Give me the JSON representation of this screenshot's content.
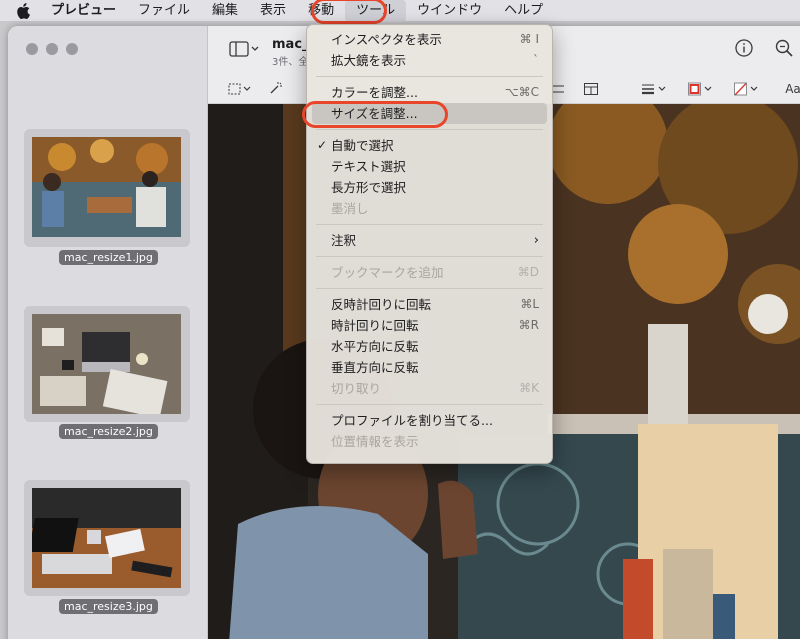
{
  "menubar": {
    "apple_icon": "apple-logo",
    "items": [
      "プレビュー",
      "ファイル",
      "編集",
      "表示",
      "移動",
      "ツール",
      "ウインドウ",
      "ヘルプ"
    ]
  },
  "toolbar": {
    "title": "mac_",
    "subtitle": "3件、全"
  },
  "thumbnails": [
    {
      "label": "mac_resize1.jpg"
    },
    {
      "label": "mac_resize2.jpg"
    },
    {
      "label": "mac_resize3.jpg"
    }
  ],
  "tools_menu": {
    "items": [
      {
        "label": "インスペクタを表示",
        "shortcut": "⌘ I"
      },
      {
        "label": "拡大鏡を表示",
        "shortcut": "`"
      },
      {
        "label": "カラーを調整...",
        "shortcut": "⌥⌘C"
      },
      {
        "label": "サイズを調整..."
      },
      {
        "label": "自動で選択"
      },
      {
        "label": "テキスト選択"
      },
      {
        "label": "長方形で選択"
      },
      {
        "label": "墨消し"
      },
      {
        "label": "注釈"
      },
      {
        "label": "ブックマークを追加",
        "shortcut": "⌘D"
      },
      {
        "label": "反時計回りに回転",
        "shortcut": "⌘L"
      },
      {
        "label": "時計回りに回転",
        "shortcut": "⌘R"
      },
      {
        "label": "水平方向に反転"
      },
      {
        "label": "垂直方向に反転"
      },
      {
        "label": "切り取り",
        "shortcut": "⌘K"
      },
      {
        "label": "プロファイルを割り当てる..."
      },
      {
        "label": "位置情報を表示"
      }
    ]
  },
  "colors": {
    "highlight": "#e8452a",
    "menu_bg": "#e8e4de"
  }
}
